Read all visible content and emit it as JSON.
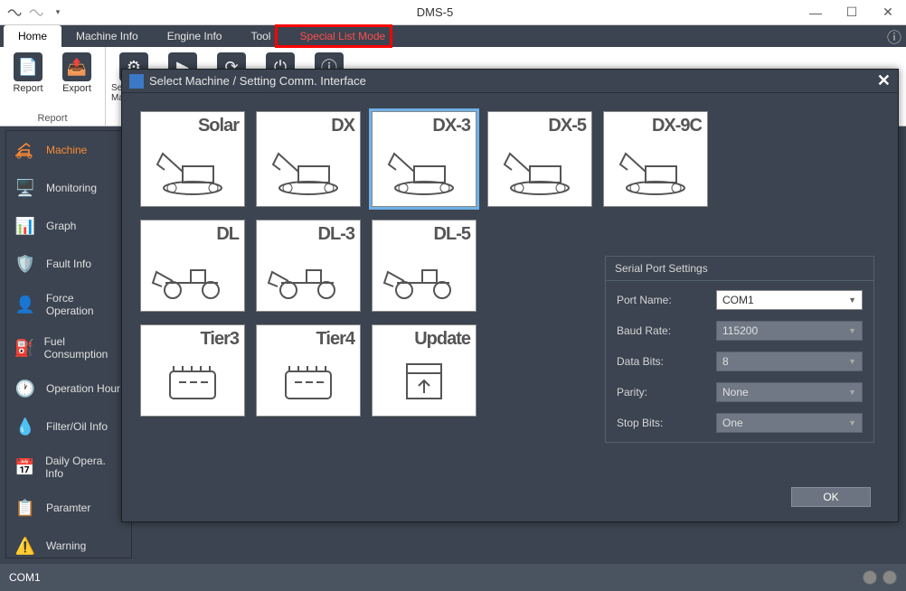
{
  "title": "DMS-5",
  "ribbon": {
    "tabs": {
      "home": "Home",
      "machine_info": "Machine Info",
      "engine_info": "Engine Info",
      "tool": "Tool",
      "special": "Special List Mode"
    },
    "buttons": {
      "report": "Report",
      "export": "Export",
      "select_machine": "Select Machine"
    },
    "group_report": "Report"
  },
  "sidebar": {
    "items": {
      "machine": "Machine",
      "monitoring": "Monitoring",
      "graph": "Graph",
      "fault": "Fault Info",
      "force": "Force Operation",
      "fuel": "Fuel Consumption",
      "ophour": "Operation Hour",
      "filter": "Filter/Oil Info",
      "daily": "Daily Opera. Info",
      "param": "Paramter",
      "warning": "Warning"
    }
  },
  "status": {
    "port": "COM1"
  },
  "dialog": {
    "title": "Select Machine / Setting Comm. Interface",
    "cards": {
      "solar": "Solar",
      "dx": "DX",
      "dx3": "DX-3",
      "dx5": "DX-5",
      "dx9c": "DX-9C",
      "dl": "DL",
      "dl3": "DL-3",
      "dl5": "DL-5",
      "tier3": "Tier3",
      "tier4": "Tier4",
      "update": "Update"
    },
    "settings": {
      "title": "Serial Port Settings",
      "labels": {
        "port": "Port Name:",
        "baud": "Baud Rate:",
        "databits": "Data Bits:",
        "parity": "Parity:",
        "stopbits": "Stop Bits:"
      },
      "values": {
        "port": "COM1",
        "baud": "115200",
        "databits": "8",
        "parity": "None",
        "stopbits": "One"
      }
    },
    "ok": "OK"
  }
}
